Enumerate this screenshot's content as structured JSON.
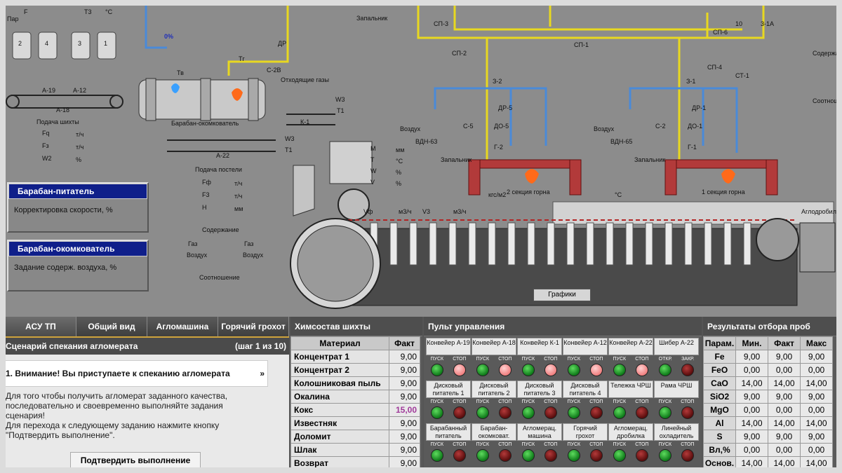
{
  "scada": {
    "top_labels": [
      "Пар",
      "F",
      "T3",
      "°C",
      "F",
      "F",
      "T3",
      "°C",
      "кгс/м2",
      "Запальник",
      "10",
      "3-1А",
      "СП-3",
      "СП-2",
      "СП-1",
      "СП-6",
      "СП-4",
      "ДР",
      "Fф",
      "%",
      "С-2В",
      "%",
      "0%"
    ],
    "hopper_numbers": [
      "2",
      "4",
      "3",
      "1"
    ],
    "pct": "%",
    "conveyor_a19": "А-19",
    "conveyor_a12": "А-12",
    "conveyor_a18": "А-18",
    "conveyor_k1": "К-1",
    "conveyor_a22": "А-22",
    "drum_label": "Барабан-окомкователь",
    "tv_label": "Тв",
    "tr_label": "Тг",
    "exhaust_label": "Отходящие газы",
    "feed_charge_label": "Подача шихты",
    "feed_bed_label": "Подача постели",
    "fq": "Fq",
    "fz": "Fз",
    "w2": "W2",
    "th": "т/ч",
    "pct2": "%",
    "ff": "Fф",
    "f3": "F3",
    "h": "H",
    "mm": "мм",
    "w3": "W3",
    "t1": "T1",
    "t1b": "T1",
    "mtwv": [
      "M",
      "T",
      "W",
      "V"
    ],
    "units_mtwv": [
      "мм",
      "°C",
      "%",
      "%"
    ],
    "content_label": "Содержание",
    "gas": "Газ",
    "air": "Воздух",
    "ratio_label": "Соотношение",
    "right_content_label": "Содержа",
    "right_ratio_label": "Соотноше",
    "air_label": "Воздух",
    "fan_left": "ВДН-63",
    "fan_right": "ВДН-65",
    "do5": "ДО-5",
    "do1": "ДО-1",
    "dr5": "ДР-5",
    "dr1": "ДР-1",
    "c5": "С-5",
    "c2": "С-2",
    "g2": "Г-2",
    "g1": "Г-1",
    "z2": "З-2",
    "z1": "З-1",
    "st1": "СТ-1",
    "furnace2": "2 секция горна",
    "furnace1": "1 секция горна",
    "zapalnik": "Запальник",
    "agglo_label": "Аглодробил",
    "row_labels_vf": "Vф",
    "row_labels_v3": "V3",
    "units_m3h": "м3/ч",
    "units_kgs": "кгс/м2",
    "units_c": "°C",
    "grafiki": "Графики"
  },
  "left_panels": {
    "feeder": {
      "title": "Барабан-питатель",
      "text": "Корректировка скорости, %"
    },
    "drum": {
      "title": "Барабан-окомкователь",
      "text": "Задание содерж. воздуха, %"
    }
  },
  "tabs": [
    "АСУ ТП",
    "Общий вид",
    "Агломашина",
    "Горячий грохот"
  ],
  "scenario": {
    "title": "Сценарий спекания агломерата",
    "step": "(шаг 1 из 10)",
    "warning": "1.  Внимание! Вы приступаете к спеканию агломерата",
    "chevron": "»",
    "text": [
      "Для того чтобы получить агломерат заданного качества,",
      "последовательно и своевременно выполняйте задания",
      "сценария!",
      "Для перехода к следующему заданию нажмите кнопку",
      "\"Подтвердить выполнение\"."
    ],
    "confirm": "Подтвердить выполнение"
  },
  "chem": {
    "title": "Химсостав шихты",
    "col_material": "Материал",
    "col_fact": "Факт",
    "rows": [
      {
        "m": "Концентрат 1",
        "v": "9,00"
      },
      {
        "m": "Концентрат 2",
        "v": "9,00"
      },
      {
        "m": "Колошниковая пыль",
        "v": "9,00"
      },
      {
        "m": "Окалина",
        "v": "9,00"
      },
      {
        "m": "Кокс",
        "v": "15,00"
      },
      {
        "m": "Известняк",
        "v": "9,00"
      },
      {
        "m": "Доломит",
        "v": "9,00"
      },
      {
        "m": "Шлак",
        "v": "9,00"
      },
      {
        "m": "Возврат",
        "v": "9,00"
      }
    ]
  },
  "pult": {
    "title": "Пульт управления",
    "devices": [
      {
        "name": "Конвейер А-19",
        "a": "ПУСК",
        "b": "СТОП",
        "l1": "g",
        "l2": "p"
      },
      {
        "name": "Конвейер А-18",
        "a": "ПУСК",
        "b": "СТОП",
        "l1": "g",
        "l2": "p"
      },
      {
        "name": "Конвейер К-1",
        "a": "ПУСК",
        "b": "СТОП",
        "l1": "g",
        "l2": "p"
      },
      {
        "name": "Конвейер А-12",
        "a": "ПУСК",
        "b": "СТОП",
        "l1": "g",
        "l2": "p"
      },
      {
        "name": "Конвейер А-22",
        "a": "ПУСК",
        "b": "СТОП",
        "l1": "g",
        "l2": "p"
      },
      {
        "name": "Шибер А-22",
        "a": "ОТКР.",
        "b": "ЗАКР.",
        "l1": "g",
        "l2": "r"
      },
      {
        "name": "Дисковый питатель 1",
        "a": "ПУСК",
        "b": "СТОП",
        "l1": "g",
        "l2": "r"
      },
      {
        "name": "Дисковый питатель 2",
        "a": "ПУСК",
        "b": "СТОП",
        "l1": "g",
        "l2": "r"
      },
      {
        "name": "Дисковый питатель 3",
        "a": "ПУСК",
        "b": "СТОП",
        "l1": "g",
        "l2": "r"
      },
      {
        "name": "Дисковый питатель 4",
        "a": "ПУСК",
        "b": "СТОП",
        "l1": "g",
        "l2": "r"
      },
      {
        "name": "Тележка ЧРШ",
        "a": "ПУСК",
        "b": "СТОП",
        "l1": "g",
        "l2": "r"
      },
      {
        "name": "Рама ЧРШ",
        "a": "ПУСК",
        "b": "СТОП",
        "l1": "g",
        "l2": "r"
      },
      {
        "name": "Барабанный питатель",
        "a": "ПУСК",
        "b": "СТОП",
        "l1": "g",
        "l2": "r"
      },
      {
        "name": "Барабан-окомковат.",
        "a": "ПУСК",
        "b": "СТОП",
        "l1": "g",
        "l2": "r"
      },
      {
        "name": "Агломерац. машина",
        "a": "ПУСК",
        "b": "СТОП",
        "l1": "g",
        "l2": "r"
      },
      {
        "name": "Горячий грохот",
        "a": "ПУСК",
        "b": "СТОП",
        "l1": "g",
        "l2": "r"
      },
      {
        "name": "Агломерац. дробилка",
        "a": "ПУСК",
        "b": "СТОП",
        "l1": "g",
        "l2": "r"
      },
      {
        "name": "Линейный охладитель",
        "a": "ПУСК",
        "b": "СТОП",
        "l1": "g",
        "l2": "r"
      }
    ]
  },
  "results": {
    "title": "Результаты отбора проб",
    "cols": [
      "Парам.",
      "Мин.",
      "Факт",
      "Макс"
    ],
    "rows": [
      [
        "Fe",
        "9,00",
        "9,00",
        "9,00"
      ],
      [
        "FeO",
        "0,00",
        "0,00",
        "0,00"
      ],
      [
        "CaO",
        "14,00",
        "14,00",
        "14,00"
      ],
      [
        "SiO2",
        "9,00",
        "9,00",
        "9,00"
      ],
      [
        "MgO",
        "0,00",
        "0,00",
        "0,00"
      ],
      [
        "Al",
        "14,00",
        "14,00",
        "14,00"
      ],
      [
        "S",
        "9,00",
        "9,00",
        "9,00"
      ],
      [
        "Вл,%",
        "0,00",
        "0,00",
        "0,00"
      ],
      [
        "Основ.",
        "14,00",
        "14,00",
        "14,00"
      ]
    ]
  }
}
